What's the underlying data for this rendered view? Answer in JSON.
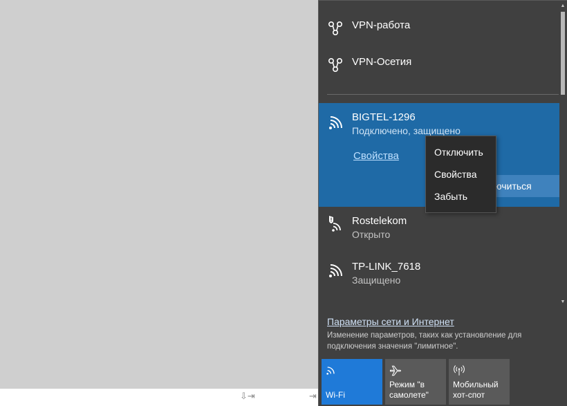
{
  "vpn": [
    {
      "label": "VPN-работа",
      "icon": "vpn-icon"
    },
    {
      "label": "VPN-Осетия",
      "icon": "vpn-icon"
    }
  ],
  "selected_network": {
    "name": "BIGTEL-1296",
    "status": "Подключено, защищено",
    "properties_link": "Свойства",
    "disconnect_button": "лючиться"
  },
  "networks": [
    {
      "name": "Rostelekom",
      "status": "Открыто",
      "icon": "wifi-open-warning-icon"
    },
    {
      "name": "TP-LINK_7618",
      "status": "Защищено",
      "icon": "wifi-icon"
    }
  ],
  "settings": {
    "link": "Параметры сети и Интернет",
    "description": "Изменение параметров, таких как установление для подключения значения \"лимитное\"."
  },
  "tiles": {
    "wifi": "Wi-Fi",
    "airplane_line1": "Режим \"в",
    "airplane_line2": "самолете\"",
    "hotspot_line1": "Мобильный",
    "hotspot_line2": "хот-спот"
  },
  "context_menu": {
    "disconnect": "Отключить",
    "properties": "Свойства",
    "forget": "Забыть"
  },
  "colors": {
    "panel_bg": "#404040",
    "selected_bg": "#1f6aa6",
    "tile_active": "#1f7ad8",
    "menu_bg": "#2b2b2b"
  }
}
